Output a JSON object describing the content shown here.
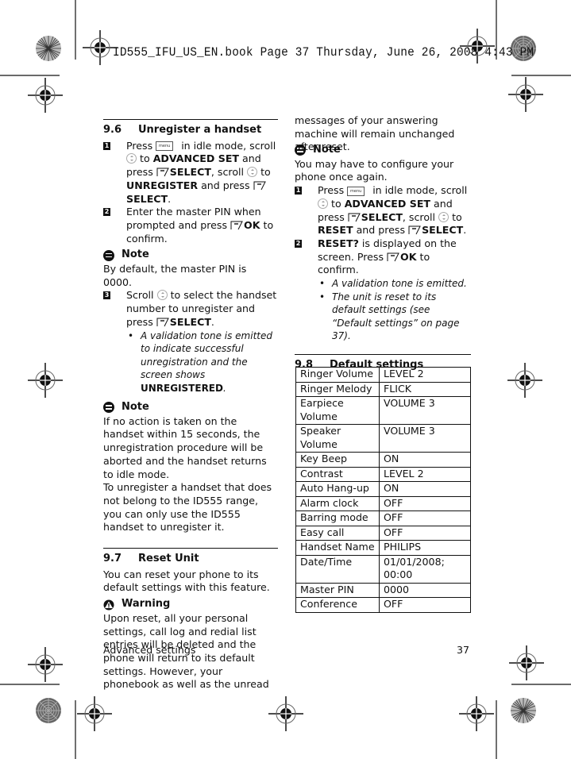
{
  "print_header": "ID555_IFU_US_EN.book  Page 37  Thursday, June 26, 2008  4:43 PM",
  "icons": {
    "menu_key": "menu-key-icon",
    "soft_key": "soft-key-icon",
    "nav_key": "navigation-key-icon",
    "note": "note-icon",
    "warning": "warning-icon",
    "registration_mark": "crosshair-registration-icon",
    "color_wheel": "starburst-color-target-icon"
  },
  "menu_key_label": "menu",
  "section_9_6": {
    "number": "9.6",
    "title": "Unregister a handset",
    "step1": {
      "num": "1",
      "t1": "Press",
      "t2": "in idle mode, scroll",
      "t3": "to",
      "b1": "ADVANCED SET",
      "t4": "and press",
      "b2": "SELECT",
      "t5": ", scroll",
      "t6": "to",
      "b3": "UNREGISTER",
      "t7": "and press",
      "b4": "SELECT",
      "t8": "."
    },
    "step2": {
      "num": "2",
      "t1": "Enter the master PIN when prompted and press",
      "b1": "OK",
      "t2": "to confirm."
    },
    "note1": {
      "label": "Note",
      "text": "By default, the master PIN is 0000."
    },
    "step3": {
      "num": "3",
      "t1": "Scroll",
      "t2": "to select the handset number to unregister and press",
      "b1": "SELECT",
      "t3": ".",
      "bullet": "A validation tone is emitted to indicate successful unregistration and the screen shows",
      "bullet_bold": "UNREGISTERED",
      "bullet_end": "."
    },
    "note2": {
      "label": "Note",
      "text1": "If no action is taken on the handset within 15 seconds, the unregistration procedure will be aborted and the handset returns to idle mode.",
      "text2": "To unregister a handset that does not belong to the ID555 range, you can only use the ID555 handset to unregister it."
    }
  },
  "section_9_7": {
    "number": "9.7",
    "title": "Reset Unit",
    "intro": "You can reset your phone to its default settings with this feature.",
    "warning": {
      "label": "Warning",
      "text": "Upon reset, all your personal settings, call log and redial list entries will be deleted and the phone will return to its default settings. However, your phonebook as well as the unread messages of your answering machine will remain unchanged after reset."
    },
    "note": {
      "label": "Note",
      "text": "You may have to configure your phone once again."
    },
    "step1": {
      "num": "1",
      "t1": "Press",
      "t2": "in idle mode, scroll",
      "t3": "to",
      "b1": "ADVANCED SET",
      "t4": "and press",
      "b2": "SELECT",
      "t5": ", scroll",
      "t6": "to",
      "b3": "RESET",
      "t7": "and press",
      "b4": "SELECT",
      "t8": "."
    },
    "step2": {
      "num": "2",
      "b1": "RESET?",
      "t1": "is displayed on the screen. Press",
      "b2": "OK",
      "t2": "to confirm.",
      "bullets": [
        "A validation tone is emitted.",
        "The unit is reset to its default settings (see “Default settings” on page 37)."
      ]
    }
  },
  "section_9_8": {
    "number": "9.8",
    "title": "Default settings",
    "rows": [
      {
        "setting": "Ringer Volume",
        "value": "LEVEL 2"
      },
      {
        "setting": "Ringer Melody",
        "value": "FLICK"
      },
      {
        "setting": "Earpiece Volume",
        "value": "VOLUME 3"
      },
      {
        "setting": "Speaker Volume",
        "value": "VOLUME 3"
      },
      {
        "setting": "Key Beep",
        "value": "ON"
      },
      {
        "setting": "Contrast",
        "value": "LEVEL 2"
      },
      {
        "setting": "Auto Hang-up",
        "value": "ON"
      },
      {
        "setting": "Alarm clock",
        "value": "OFF"
      },
      {
        "setting": "Barring mode",
        "value": "OFF"
      },
      {
        "setting": "Easy call",
        "value": "OFF"
      },
      {
        "setting": "Handset Name",
        "value": "PHILIPS"
      },
      {
        "setting": "Date/Time",
        "value": "01/01/2008; 00:00"
      },
      {
        "setting": "Master PIN",
        "value": "0000"
      },
      {
        "setting": "Conference",
        "value": "OFF"
      }
    ]
  },
  "footer": {
    "section_name": "Advanced settings",
    "page_number": "37"
  }
}
